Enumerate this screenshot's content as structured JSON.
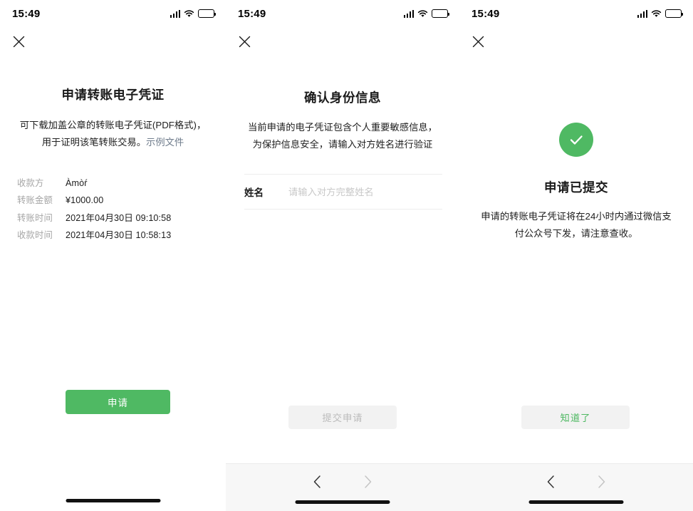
{
  "status_bar": {
    "time": "15:49",
    "signal_icon": "signal-bars-icon",
    "wifi_icon": "wifi-icon",
    "battery_icon": "battery-icon"
  },
  "colors": {
    "brand_green": "#4fb963",
    "link_gray_blue": "#6f7c8c",
    "disabled_bg": "#f2f2f2",
    "disabled_text": "#bcbcbc",
    "label_gray": "#a6a6a6",
    "nav_bg": "#f7f7f7"
  },
  "screen1": {
    "close_label": "✕",
    "title": "申请转账电子凭证",
    "desc_line1": "可下载加盖公章的转账电子凭证(PDF格式)，",
    "desc_line2": "用于证明该笔转账交易。",
    "sample_link": "示例文件",
    "details": [
      {
        "label": "收款方",
        "value": "Àmòŕ"
      },
      {
        "label": "转账金额",
        "value": "¥1000.00"
      },
      {
        "label": "转账时间",
        "value": "2021年04月30日 09:10:58"
      },
      {
        "label": "收款时间",
        "value": "2021年04月30日 10:58:13"
      }
    ],
    "primary_button": "申请"
  },
  "screen2": {
    "close_label": "✕",
    "title": "确认身份信息",
    "desc_line1": "当前申请的电子凭证包含个人重要敏感信息，",
    "desc_line2": "为保护信息安全，请输入对方姓名进行验证",
    "field_label": "姓名",
    "field_placeholder": "请输入对方完整姓名",
    "field_value": "",
    "submit_button": "提交申请",
    "nav_back_icon": "chevron-left-icon",
    "nav_forward_icon": "chevron-right-icon"
  },
  "screen3": {
    "close_label": "✕",
    "success_icon": "check-circle-icon",
    "title": "申请已提交",
    "desc_line1": "申请的转账电子凭证将在24小时内通过微信支",
    "desc_line2": "付公众号下发，请注意查收。",
    "ack_button": "知道了",
    "nav_back_icon": "chevron-left-icon",
    "nav_forward_icon": "chevron-right-icon"
  }
}
